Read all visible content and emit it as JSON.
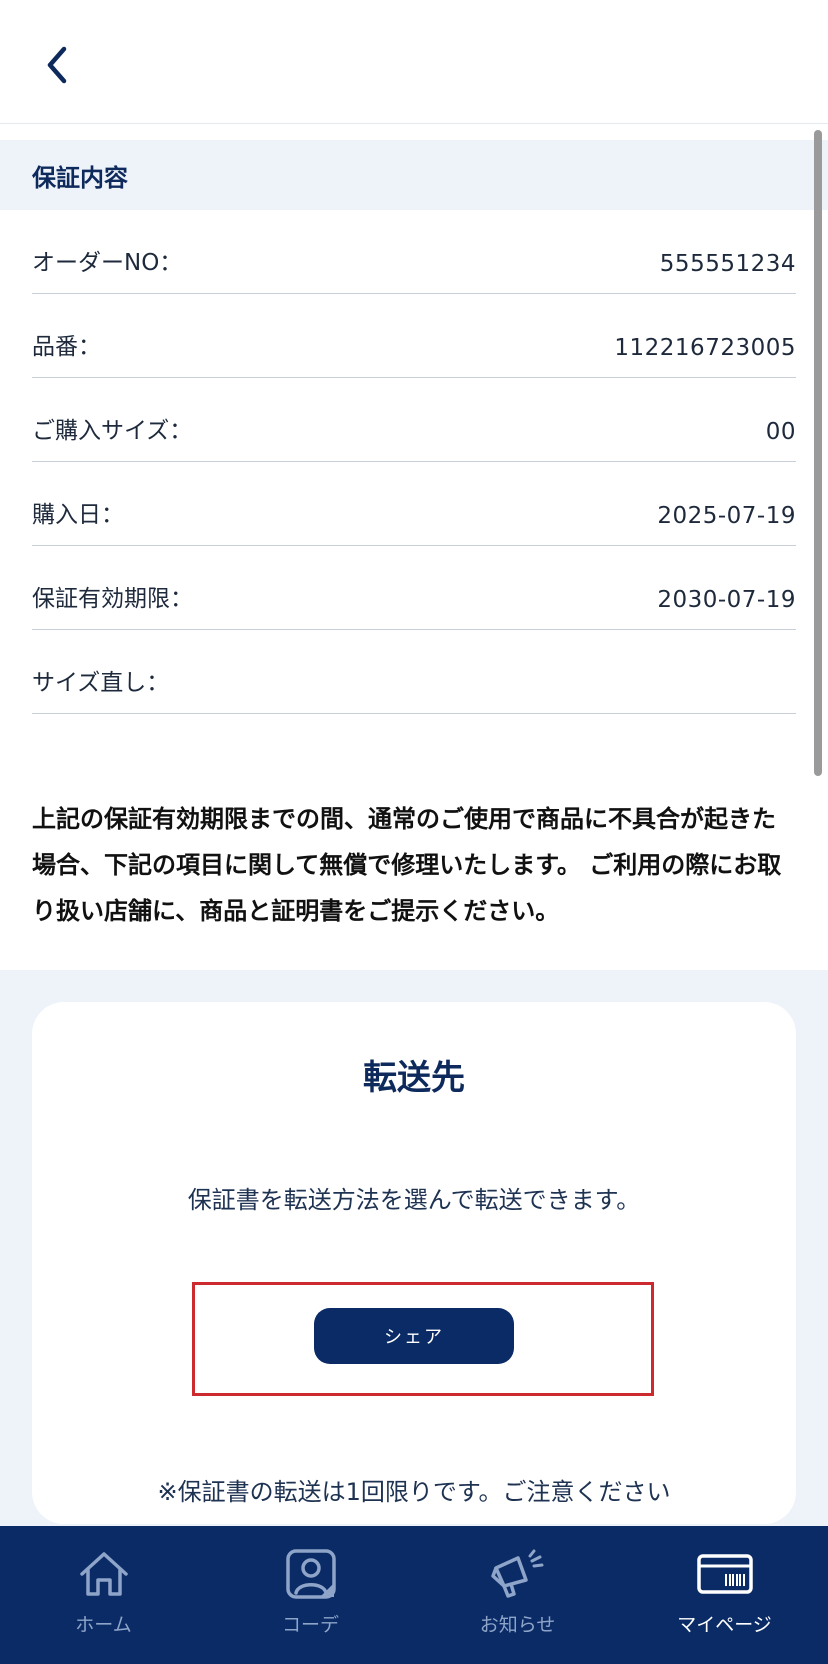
{
  "header": {
    "back_icon": "chevron-left-icon"
  },
  "section": {
    "title": "保証内容"
  },
  "fields": [
    {
      "label": "オーダーNO：",
      "value": "555551234"
    },
    {
      "label": "品番：",
      "value": "112216723005"
    },
    {
      "label": "ご購入サイズ：",
      "value": "00"
    },
    {
      "label": "購入日：",
      "value": "2025-07-19"
    },
    {
      "label": "保証有効期限：",
      "value": "2030-07-19"
    },
    {
      "label": "サイズ直し：",
      "value": ""
    }
  ],
  "notice": "上記の保証有効期限までの間、通常のご使用で商品に不具合が起きた場合、下記の項目に関して無償で修理いたします。 ご利用の際にお取り扱い店舗に、商品と証明書をご提示ください。",
  "transfer": {
    "title": "転送先",
    "description": "保証書を転送方法を選んで転送できます。",
    "share_label": "シェア",
    "note": "※保証書の転送は1回限りです。ご注意ください"
  },
  "nav": {
    "items": [
      {
        "label": "ホーム",
        "icon": "home-icon"
      },
      {
        "label": "コーデ",
        "icon": "coordinate-icon"
      },
      {
        "label": "お知らせ",
        "icon": "megaphone-icon"
      },
      {
        "label": "マイページ",
        "icon": "card-icon"
      }
    ],
    "active": "マイページ"
  },
  "colors": {
    "primary": "#0a2b66",
    "section_bg": "#eef3fa",
    "highlight": "#cc2a2f"
  }
}
